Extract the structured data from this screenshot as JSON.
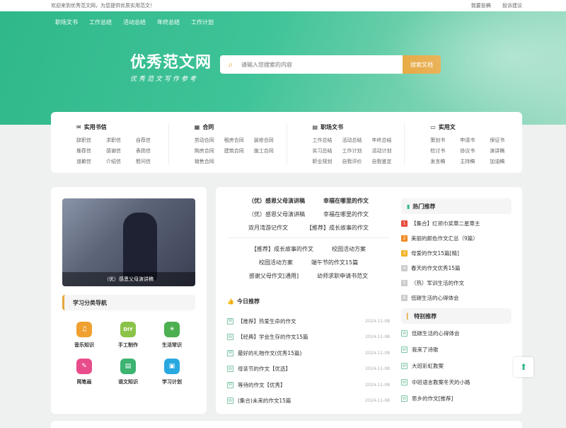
{
  "topbar": {
    "welcome": "欢迎来到优秀范文网，为您提供优质实用范文！",
    "links": [
      "我要投稿",
      "投诉建议"
    ]
  },
  "nav": [
    "职场文书",
    "工作总结",
    "活动总结",
    "年终总结",
    "工作计划"
  ],
  "logo": {
    "title": "优秀范文网",
    "slogan": "优秀范文写作参考"
  },
  "search": {
    "placeholder": "请输入您搜索的内容",
    "button": "搜索文档"
  },
  "categories": [
    {
      "title": "实用书信",
      "icon": "mail-icon",
      "items": [
        "辞职信",
        "求职信",
        "自荐信",
        "推荐信",
        "感谢信",
        "表扬信",
        "道歉信",
        "介绍信",
        "慰问信"
      ]
    },
    {
      "title": "合同",
      "icon": "contract-icon",
      "items": [
        "劳动合同",
        "租房合同",
        "装修合同",
        "购房合同",
        "建筑合同",
        "施工合同",
        "销售合同"
      ]
    },
    {
      "title": "职场文书",
      "icon": "document-icon",
      "items": [
        "工作总结",
        "活动总结",
        "年终总结",
        "实习总结",
        "工作计划",
        "活动计划",
        "职业规划",
        "自我评价",
        "自我鉴定"
      ]
    },
    {
      "title": "实用文",
      "icon": "folder-icon",
      "items": [
        "策划书",
        "申请书",
        "保证书",
        "检讨书",
        "协议书",
        "演讲稿",
        "发言稿",
        "主持稿",
        "加油稿"
      ]
    }
  ],
  "featured": {
    "caption": "（优）感恩父母演讲稿"
  },
  "study": {
    "title": "学习分类导航",
    "items": [
      {
        "label": "音乐知识",
        "color": "#f0a030",
        "glyph": "♫"
      },
      {
        "label": "手工制作",
        "color": "#8bc34a",
        "glyph": "DIY"
      },
      {
        "label": "生活常识",
        "color": "#4caf50",
        "glyph": "☀"
      },
      {
        "label": "简笔画",
        "color": "#e84c8b",
        "glyph": "✎"
      },
      {
        "label": "语文知识",
        "color": "#3cb371",
        "glyph": "▤"
      },
      {
        "label": "学习计划",
        "color": "#29a8e0",
        "glyph": "▣"
      }
    ]
  },
  "hot_links": {
    "group1": [
      {
        "items": [
          "（优）感恩父母演讲稿",
          "幸福在哪里的作文"
        ],
        "bold": true
      },
      {
        "items": [
          "（优）感恩父母演讲稿",
          "幸福在哪里的作文"
        ],
        "bold": false
      },
      {
        "items": [
          "双月湾游记作文",
          "【推荐】成长故事的作文"
        ],
        "bold": false
      }
    ],
    "group2": [
      {
        "items": [
          "【推荐】成长故事的作文",
          "校园活动方案"
        ],
        "bold": false
      },
      {
        "items": [
          "校园活动方案",
          "端午节的作文15篇"
        ],
        "bold": false
      },
      {
        "items": [
          "感谢父母作文[通用]",
          "幼师求职申请书范文"
        ],
        "bold": false
      }
    ]
  },
  "today": {
    "title": "今日推荐",
    "items": [
      {
        "title": "【推荐】热爱生命的作文",
        "date": "2024-11-08"
      },
      {
        "title": "【经典】学会生存的作文15篇",
        "date": "2024-11-08"
      },
      {
        "title": "最好的礼物作文(优秀15篇)",
        "date": "2024-11-08"
      },
      {
        "title": "母亲节的作文【优选】",
        "date": "2024-11-08"
      },
      {
        "title": "等待的作文【优秀】",
        "date": "2024-11-08"
      },
      {
        "title": "(集合)未来的作文15篇",
        "date": "2024-11-08"
      }
    ]
  },
  "hot": {
    "title": "热门推荐",
    "items": [
      {
        "n": "1",
        "title": "【集合】红领巾奖章二星章主",
        "color": "#e74c3c"
      },
      {
        "n": "2",
        "title": "美丽的颜色作文汇总（9篇）",
        "color": "#f08a24"
      },
      {
        "n": "3",
        "title": "母爱的作文15篇[精]",
        "color": "#f0b429"
      },
      {
        "n": "4",
        "title": "春天的作文优秀15篇",
        "color": "#cccccc"
      },
      {
        "n": "5",
        "title": "（热）军训生活的作文",
        "color": "#cccccc"
      },
      {
        "n": "6",
        "title": "低碳生活的心得体会",
        "color": "#cccccc"
      }
    ]
  },
  "special": {
    "title": "特别推荐",
    "items": [
      "低碳生活的心得体会",
      "我来了诗歌",
      "大班彩虹教案",
      "中班语言教案冬天的小路",
      "思乡的作文[推荐]"
    ]
  },
  "totop": {
    "icon": "arrow-up-icon"
  }
}
